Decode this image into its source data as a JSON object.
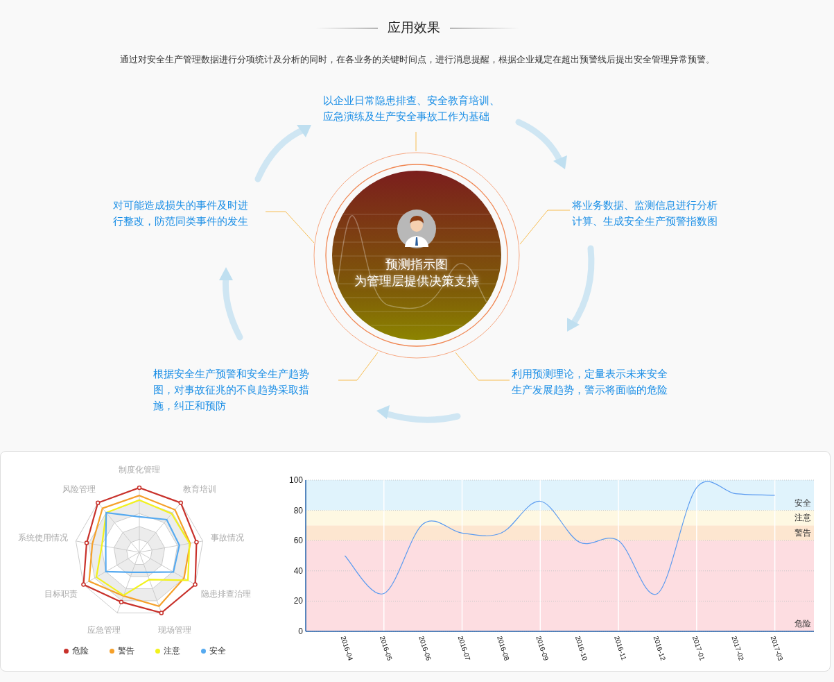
{
  "header": {
    "title": "应用效果",
    "description": "通过对安全生产管理数据进行分项统计及分析的同时，在各业务的关键时间点，进行消息提醒，根据企业规定在超出预警线后提出安全管理异常预警。"
  },
  "diagram": {
    "center_lines": [
      "预测指示图",
      "为管理层提供决策支持"
    ],
    "steps": [
      {
        "kind": "top",
        "lines": [
          "以企业日常隐患排查、安全教育培训、",
          "应急演练及生产安全事故工作为基础"
        ]
      },
      {
        "kind": "left",
        "lines": [
          "对可能造成损失的事件及时进",
          "行整改，防范同类事件的发生"
        ]
      },
      {
        "kind": "right",
        "lines": [
          "将业务数据、监测信息进行分析",
          "计算、生成安全生产预警指数图"
        ]
      },
      {
        "kind": "bottom_left",
        "lines": [
          "根据安全生产预警和安全生产趋势",
          "图，对事故征兆的不良趋势采取措",
          "施，纠正和预防"
        ]
      },
      {
        "kind": "bottom_right",
        "lines": [
          "利用预测理论，定量表示未来安全",
          "生产发展趋势，警示将面临的危险"
        ]
      }
    ]
  },
  "radar": {
    "axes": [
      "制度化管理",
      "风险管理",
      "教育培训",
      "系统使用情况",
      "事故情况",
      "目标职责",
      "隐患排查治理",
      "应急管理",
      "现场管理"
    ],
    "legend": [
      {
        "label": "危险",
        "color": "#c8312b"
      },
      {
        "label": "警告",
        "color": "#f5a02a"
      },
      {
        "label": "注意",
        "color": "#f2f21c"
      },
      {
        "label": "安全",
        "color": "#56aaf0"
      }
    ]
  },
  "trend": {
    "chart_data": {
      "type": "line",
      "categories": [
        "2016-04",
        "2016-05",
        "2016-06",
        "2016-07",
        "2016-08",
        "2016-09",
        "2016-10",
        "2016-11",
        "2016-12",
        "2017-01",
        "2017-02",
        "2017-03"
      ],
      "series": [
        {
          "color": "#5b9bf0",
          "values": [
            50,
            25,
            71,
            65,
            65,
            86,
            59,
            60,
            25,
            95,
            91,
            90
          ]
        }
      ],
      "ylim": [
        0,
        100
      ],
      "yticks": [
        0,
        20,
        40,
        60,
        80,
        100
      ],
      "grid": true,
      "bands": [
        {
          "axis": "y",
          "label": "安全",
          "from": 80,
          "to": 100,
          "color": "#e0f3fc"
        },
        {
          "axis": "y",
          "label": "注意",
          "from": 70,
          "to": 80,
          "color": "#fef8e2"
        },
        {
          "axis": "y",
          "label": "警告",
          "from": 60,
          "to": 70,
          "color": "#fde6d0"
        },
        {
          "axis": "y",
          "label": "危险",
          "from": 0,
          "to": 60,
          "color": "#fddde1"
        }
      ]
    }
  }
}
